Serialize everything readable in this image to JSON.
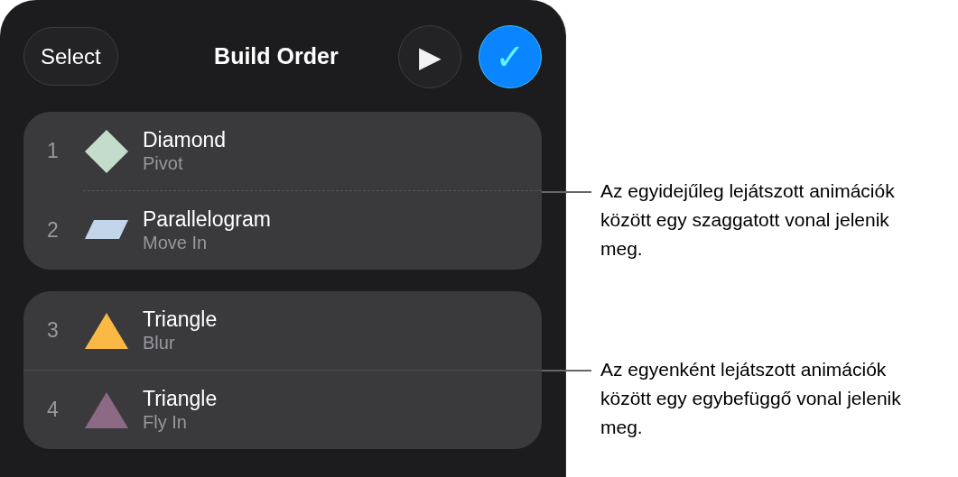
{
  "header": {
    "select_button": "Select",
    "title": "Build Order",
    "play_button": "▶",
    "done_button": "✓"
  },
  "groups": [
    {
      "dashed_divider": true,
      "items": [
        {
          "number": "1",
          "name": "Diamond",
          "effect": "Pivot",
          "kind": "diamond",
          "color": "#c4dccb"
        },
        {
          "number": "2",
          "name": "Parallelogram",
          "effect": "Move In",
          "kind": "parallelogram",
          "color": "#c3d6e9"
        }
      ]
    },
    {
      "dashed_divider": false,
      "items": [
        {
          "number": "3",
          "name": "Triangle",
          "effect": "Blur",
          "kind": "triangle",
          "color": "#fab845"
        },
        {
          "number": "4",
          "name": "Triangle",
          "effect": "Fly In",
          "kind": "triangle",
          "color": "#8c6a85"
        }
      ]
    }
  ],
  "annotations": [
    "Az egyidejűleg lejátszott animációk között egy szaggatott vonal jelenik meg.",
    "Az egyenként lejátszott animációk között egy egybefüggő vonal jelenik meg."
  ]
}
